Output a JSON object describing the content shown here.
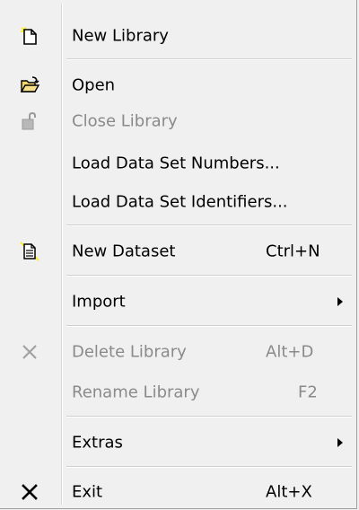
{
  "menu": {
    "new_library": {
      "label": "New Library",
      "icon": "new-document-icon"
    },
    "open": {
      "label": "Open",
      "icon": "open-folder-icon"
    },
    "close_library": {
      "label": "Close Library",
      "icon": "close-lock-icon"
    },
    "load_numbers": {
      "label": "Load Data Set Numbers..."
    },
    "load_identifiers": {
      "label": "Load Data Set Identifiers..."
    },
    "new_dataset": {
      "label": "New Dataset",
      "shortcut": "Ctrl+N",
      "icon": "new-dataset-icon"
    },
    "import": {
      "label": "Import"
    },
    "delete_library": {
      "label": "Delete Library",
      "shortcut": "Alt+D",
      "icon": "delete-x-icon"
    },
    "rename_library": {
      "label": "Rename Library",
      "shortcut": "F2"
    },
    "extras": {
      "label": "Extras"
    },
    "exit": {
      "label": "Exit",
      "shortcut": "Alt+X",
      "icon": "exit-x-icon"
    }
  },
  "colors": {
    "background": "#f0f0f0",
    "disabled_text": "#8a8a8a",
    "highlight_yellow": "#ffee00"
  }
}
